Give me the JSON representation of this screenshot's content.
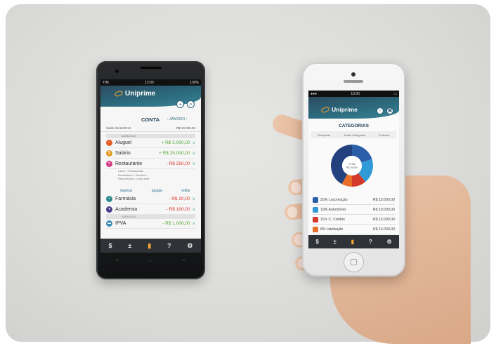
{
  "android": {
    "status": {
      "carrier": "TIM",
      "time": "13:00",
      "battery": "100%"
    },
    "app_name": "Uniprime",
    "title": "CONTA",
    "month": "JAN/2014",
    "balance_label": "Saldo 31/12/2013",
    "balance_value": "R$ 10.000,00",
    "date1": "14/01/2014",
    "date2": "12/01/2014",
    "rows": [
      {
        "name": "Aluguel",
        "value": "+ R$ 5.000,00",
        "color": "#e65a22"
      },
      {
        "name": "Salário",
        "value": "+ R$ 25.000,00",
        "color": "#e69a22"
      },
      {
        "name": "Restaurante",
        "value": "- R$ 250,00",
        "color": "#d63a82"
      },
      {
        "name": "Farmácia",
        "value": "- R$ 20,00",
        "color": "#2a8a8a"
      },
      {
        "name": "Academia",
        "value": "- R$ 100,00",
        "color": "#4a3a8a"
      },
      {
        "name": "IPVA",
        "value": "- R$ 1.000,00",
        "color": "#3a8ab6"
      }
    ],
    "detail": [
      "Lazer > Restaurante",
      "Beneficiário > Nenhum",
      "Recorrência > Cada mês"
    ],
    "links": {
      "duplicate": "duplicar",
      "delete": "apagar",
      "edit": "editar"
    },
    "tabbar": [
      "$",
      "±",
      "▮",
      "?",
      "⚙"
    ]
  },
  "iphone": {
    "status": {
      "time": "13:00"
    },
    "app_name": "Uniprime",
    "title": "CATEGORIAS",
    "tabs": [
      "Despesas",
      "Todas Categorias",
      "6 Meses"
    ],
    "donut_total_label": "TOTAL",
    "donut_total_value": "R$ 25.000",
    "slices": [
      {
        "name": "Locomoção",
        "pct": 20,
        "color": "#2a5fa8"
      },
      {
        "name": "Automóvel",
        "pct": 19,
        "color": "#2f9ad6"
      },
      {
        "name": "C. Crédito",
        "pct": 11,
        "color": "#d43a2a"
      },
      {
        "name": "Habitação",
        "pct": 8,
        "color": "#e8702a"
      },
      {
        "name": "Outros",
        "pct": 42,
        "color": "#23427d"
      }
    ],
    "rows": [
      {
        "label": "20% Locomoção",
        "value": "R$ 13.000,00",
        "color": "#2a5fa8"
      },
      {
        "label": "19% Automóvel",
        "value": "R$ 10.000,00",
        "color": "#2f9ad6"
      },
      {
        "label": "11% C. Crédito",
        "value": "R$ 13.000,00",
        "color": "#d43a2a"
      },
      {
        "label": "8% Habitação",
        "value": "R$ 13.000,00",
        "color": "#e8702a"
      }
    ],
    "tabbar": [
      "$",
      "±",
      "▮",
      "?",
      "⚙"
    ]
  }
}
